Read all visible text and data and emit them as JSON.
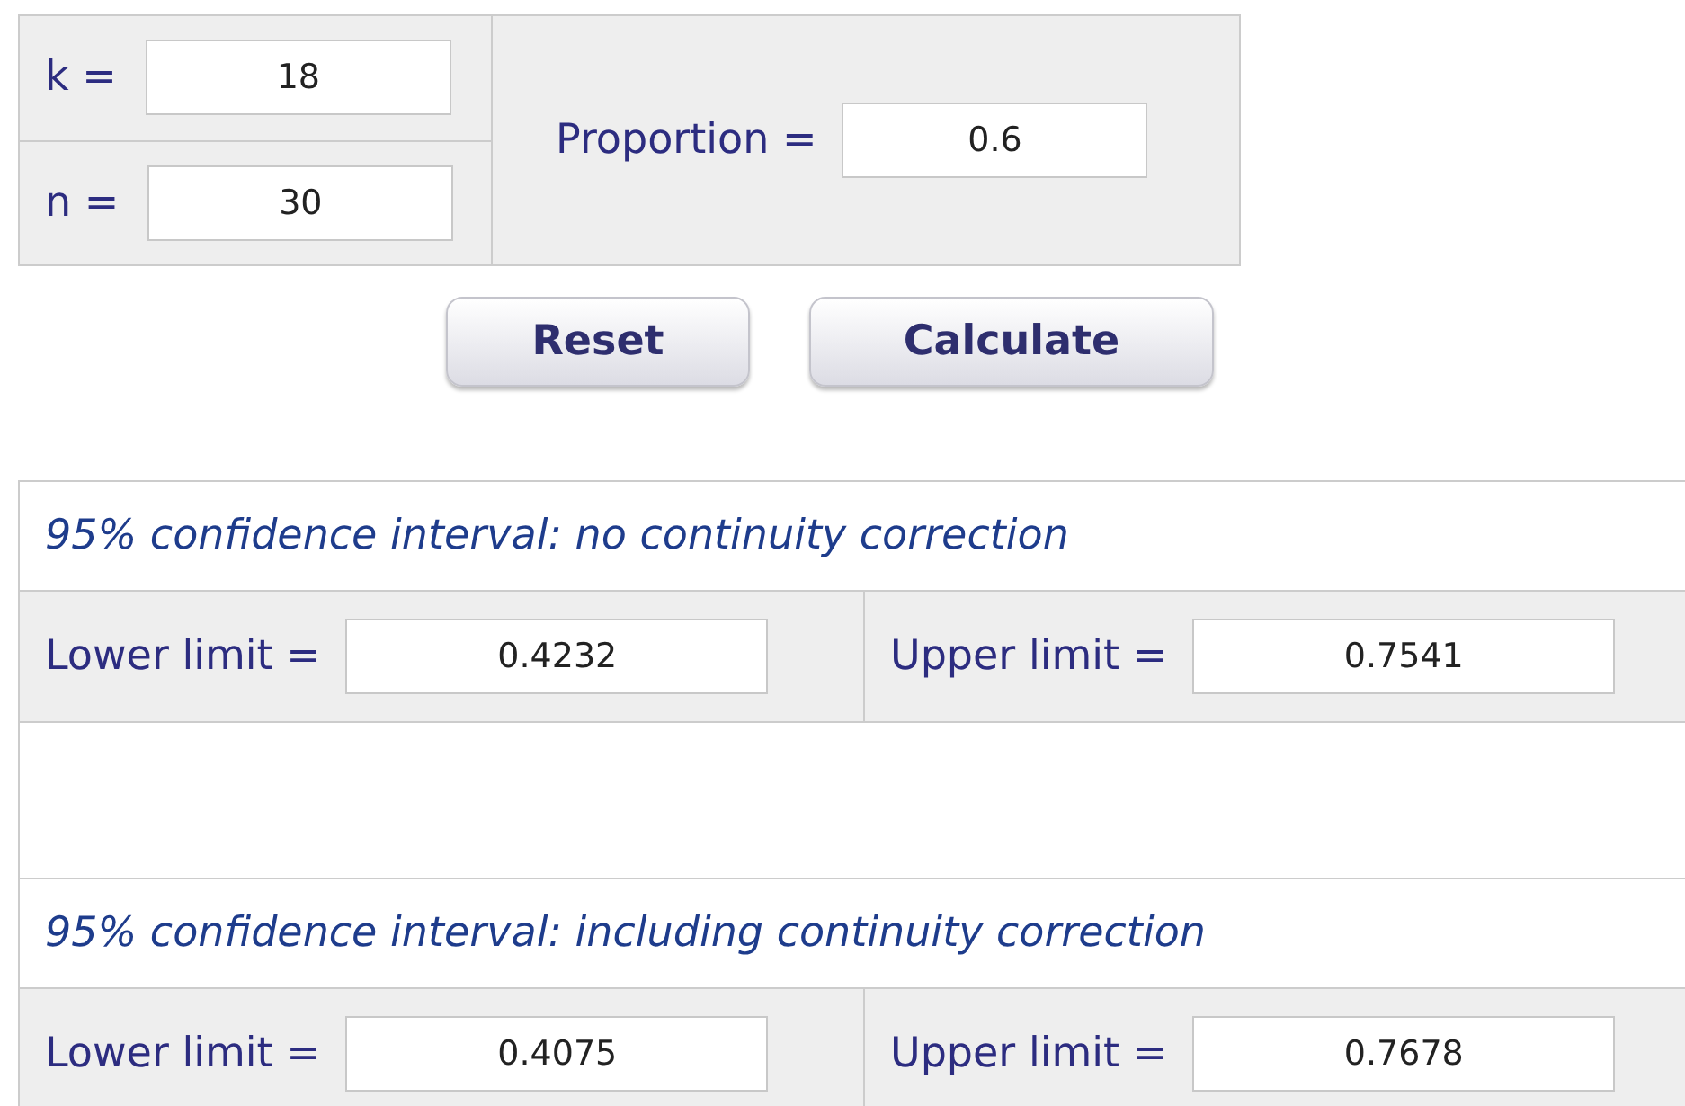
{
  "inputs": [
    {
      "label": "k =",
      "value": "18"
    },
    {
      "label": "n =",
      "value": "30"
    }
  ],
  "proportion": {
    "label": "Proportion =",
    "value": "0.6"
  },
  "buttons": [
    "Reset",
    "Calculate"
  ],
  "sections": [
    {
      "heading": "95% confidence interval: no continuity correction",
      "lower": {
        "label": "Lower limit =",
        "value": "0.4232"
      },
      "upper": {
        "label": "Upper limit =",
        "value": "0.7541"
      }
    },
    {
      "heading": "95% confidence interval: including continuity correction",
      "lower": {
        "label": "Lower limit =",
        "value": "0.4075"
      },
      "upper": {
        "label": "Upper limit =",
        "value": "0.7678"
      }
    }
  ]
}
